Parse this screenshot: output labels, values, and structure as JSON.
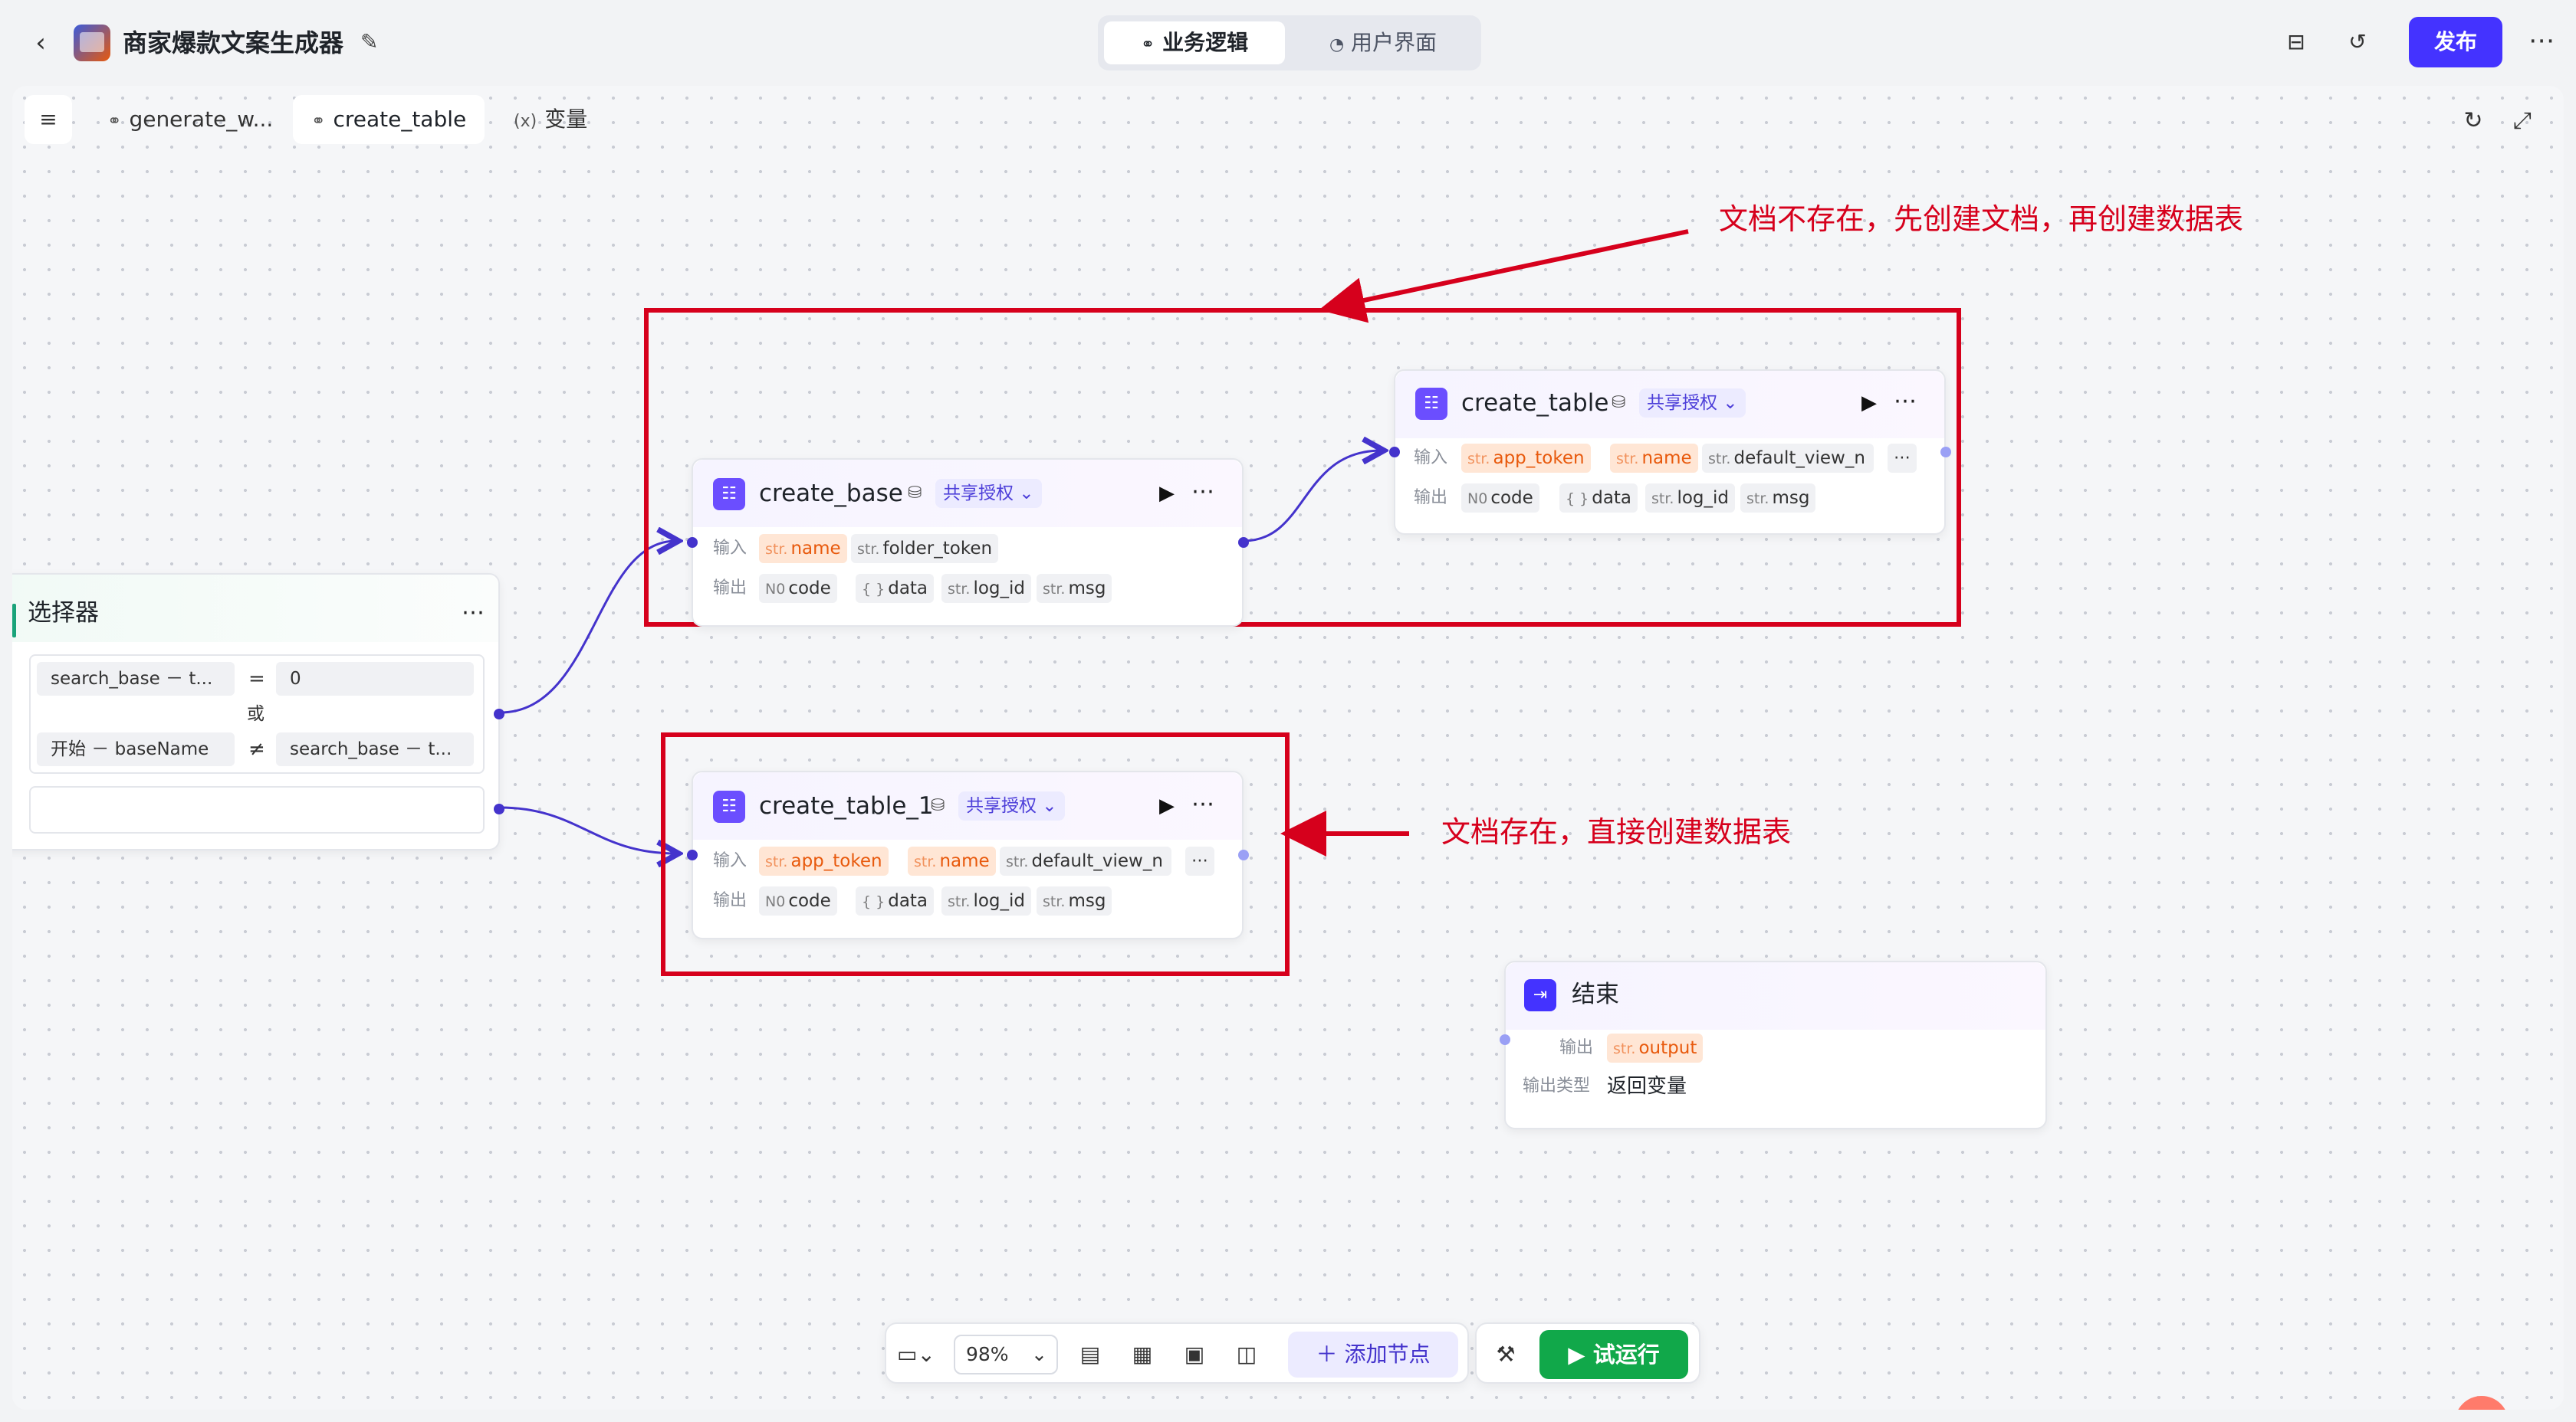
{
  "header": {
    "app_title": "商家爆款文案生成器",
    "tabs": [
      {
        "label": "业务逻辑"
      },
      {
        "label": "用户界面"
      }
    ],
    "publish_label": "发布"
  },
  "canvas_tabs": [
    {
      "label": "generate_w..."
    },
    {
      "label": "create_table"
    },
    {
      "label": "变量"
    }
  ],
  "nodes": {
    "create_base": {
      "title": "create_base",
      "share": "共享授权",
      "input_label": "输入",
      "output_label": "输出",
      "inputs": [
        {
          "type": "str.",
          "name": "name"
        },
        {
          "type": "str.",
          "name": "folder_token"
        }
      ],
      "outputs": [
        {
          "type": "N0",
          "name": "code"
        },
        {
          "type": "{ }",
          "name": "data"
        },
        {
          "type": "str.",
          "name": "log_id"
        },
        {
          "type": "str.",
          "name": "msg"
        }
      ]
    },
    "create_table": {
      "title": "create_table",
      "share": "共享授权",
      "input_label": "输入",
      "output_label": "输出",
      "inputs": [
        {
          "type": "str.",
          "name": "app_token"
        },
        {
          "type": "str.",
          "name": "name"
        },
        {
          "type": "str.",
          "name": "default_view_n"
        }
      ],
      "outputs": [
        {
          "type": "N0",
          "name": "code"
        },
        {
          "type": "{ }",
          "name": "data"
        },
        {
          "type": "str.",
          "name": "log_id"
        },
        {
          "type": "str.",
          "name": "msg"
        }
      ]
    },
    "create_table_1": {
      "title": "create_table_1",
      "share": "共享授权",
      "input_label": "输入",
      "output_label": "输出",
      "inputs": [
        {
          "type": "str.",
          "name": "app_token"
        },
        {
          "type": "str.",
          "name": "name"
        },
        {
          "type": "str.",
          "name": "default_view_n"
        }
      ],
      "outputs": [
        {
          "type": "N0",
          "name": "code"
        },
        {
          "type": "{ }",
          "name": "data"
        },
        {
          "type": "str.",
          "name": "log_id"
        },
        {
          "type": "str.",
          "name": "msg"
        }
      ]
    },
    "selector": {
      "title": "选择器",
      "cond1_left": "search_base － t...",
      "cond1_op": "=",
      "cond1_right": "0",
      "or_label": "或",
      "cond2_left": "开始 － baseName",
      "cond2_op": "≠",
      "cond2_right": "search_base － t..."
    },
    "end": {
      "title": "结束",
      "output_label": "输出",
      "output_type": "str.",
      "output_name": "output",
      "output_type_label": "输出类型",
      "output_type_value": "返回变量"
    }
  },
  "annotations": {
    "top": "文档不存在，先创建文档，再创建数据表",
    "bottom": "文档存在，直接创建数据表",
    "color": "#d6001c"
  },
  "toolbar": {
    "zoom": "98%",
    "add_node": "添加节点",
    "run": "试运行"
  },
  "colors": {
    "accent": "#4433ff",
    "run": "#11a84a"
  }
}
